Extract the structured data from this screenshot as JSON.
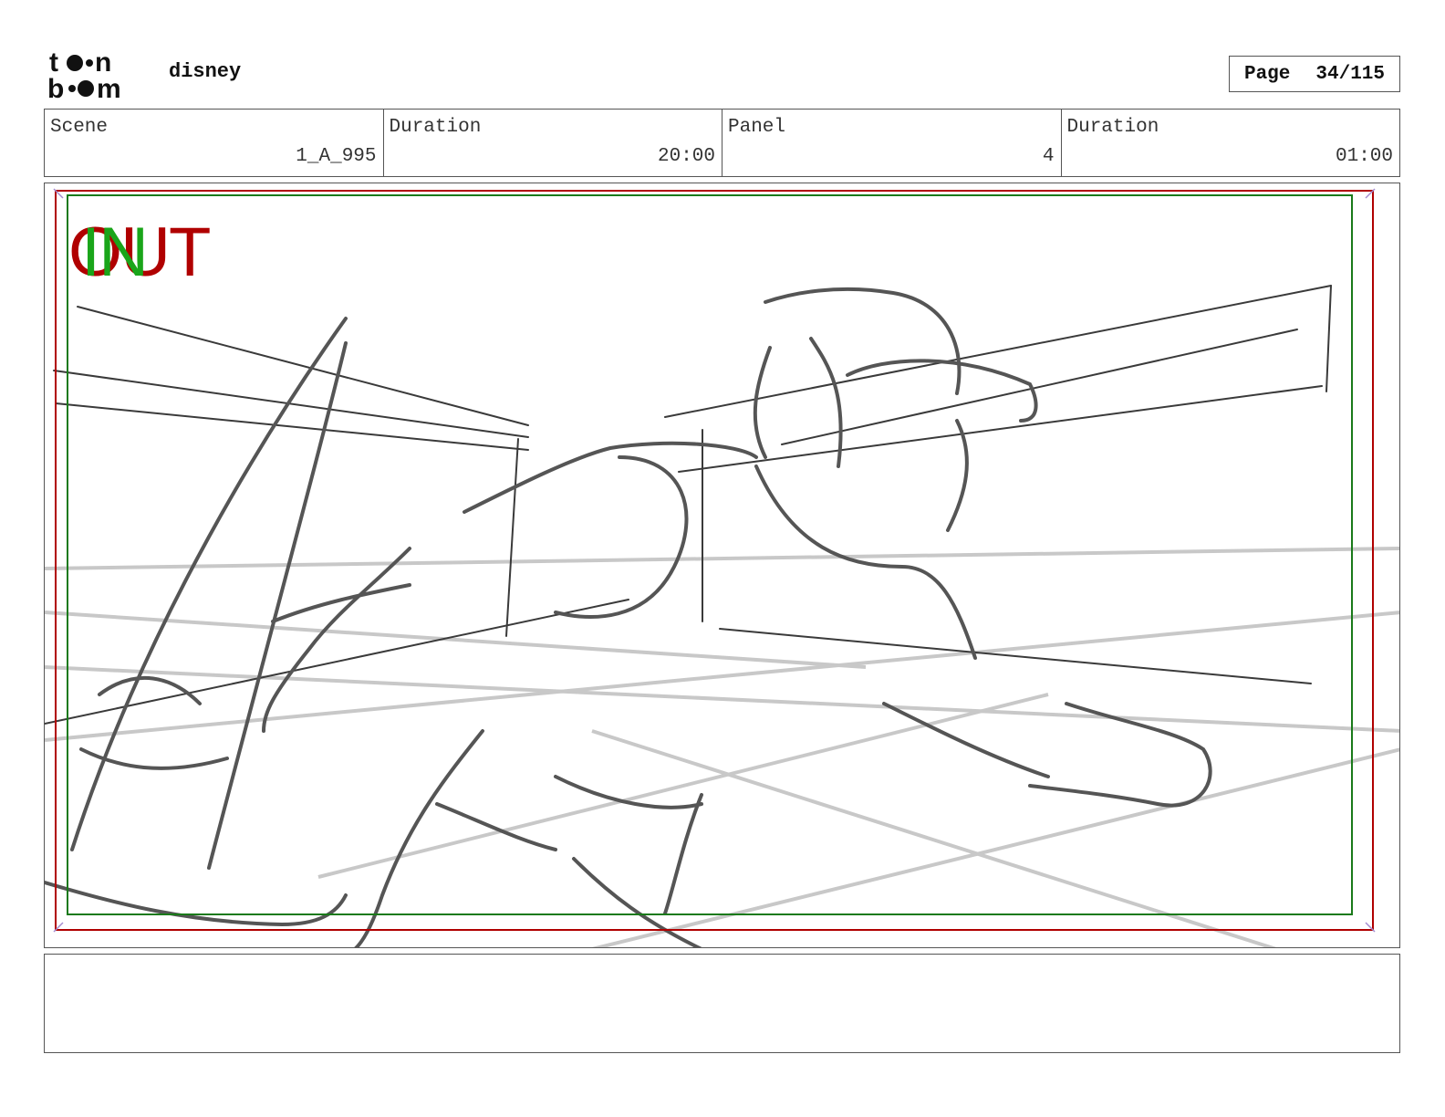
{
  "header": {
    "logo_text": "toon boom",
    "project": "disney",
    "page_label": "Page",
    "page_value": "34/115"
  },
  "info": {
    "scene_label": "Scene",
    "scene_value": "1_A_995",
    "scene_duration_label": "Duration",
    "scene_duration_value": "20:00",
    "panel_label": "Panel",
    "panel_value": "4",
    "panel_duration_label": "Duration",
    "panel_duration_value": "01:00"
  },
  "panel_image": {
    "out_marker": "OUT",
    "in_marker": "IN",
    "colors": {
      "safe_frame": "#b00000",
      "action_frame": "#1a7a1a",
      "sketch": "#444444",
      "guide": "#c8c8c8"
    }
  },
  "notes": {
    "text": ""
  }
}
